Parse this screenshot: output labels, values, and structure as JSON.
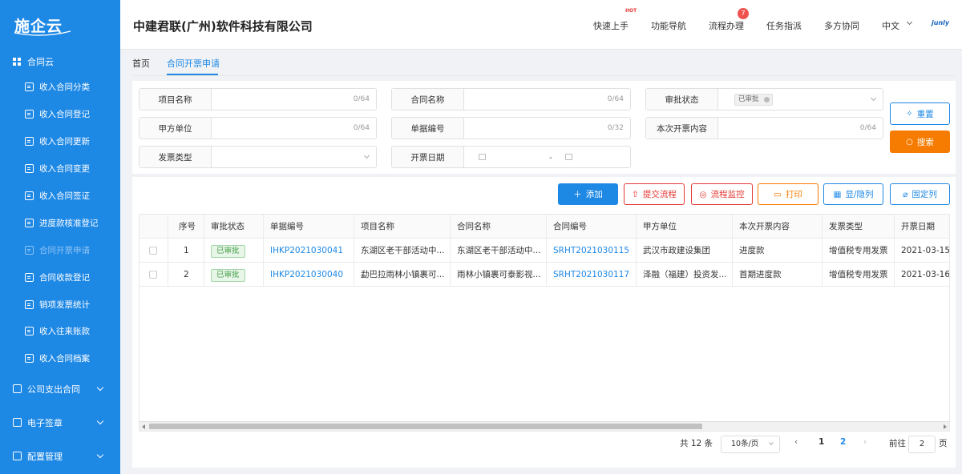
{
  "app": {
    "logo": "施企云",
    "company": "中建君联(广州)软件科技有限公司",
    "brand": "junly"
  },
  "colors": {
    "primary": "#1e88e5",
    "sidebar": "#1e88e5",
    "search_button": "#f57c00",
    "status_ok": "#43a047"
  },
  "topnav": {
    "quick_start": "快速上手",
    "hot_label": "HOT",
    "feature_nav": "功能导航",
    "process": "流程办理",
    "process_badge": "7",
    "task": "任务指派",
    "collab": "多方协同",
    "language": "中文"
  },
  "sidebar": {
    "group_title": "合同云",
    "items": [
      {
        "label": "收入合同分类"
      },
      {
        "label": "收入合同登记"
      },
      {
        "label": "收入合同更新"
      },
      {
        "label": "收入合同变更"
      },
      {
        "label": "收入合同签证"
      },
      {
        "label": "进度款核准登记"
      },
      {
        "label": "合同开票申请"
      },
      {
        "label": "合同收款登记"
      },
      {
        "label": "销项发票统计"
      },
      {
        "label": "收入往来账款"
      },
      {
        "label": "收入合同档案"
      }
    ],
    "sections": [
      {
        "label": "公司支出合同"
      },
      {
        "label": "电子签章"
      },
      {
        "label": "配置管理"
      }
    ]
  },
  "tabs": {
    "home": "首页",
    "current": "合同开票申请"
  },
  "search": {
    "project_name": {
      "label": "项目名称",
      "count": "0/64"
    },
    "contract_name": {
      "label": "合同名称",
      "count": "0/64"
    },
    "approval_status": {
      "label": "审批状态",
      "tag": "已审批"
    },
    "party_a": {
      "label": "甲方单位",
      "count": "0/64"
    },
    "doc_number": {
      "label": "单据编号",
      "count": "0/32"
    },
    "invoice_content": {
      "label": "本次开票内容",
      "count": "0/64"
    },
    "invoice_type": {
      "label": "发票类型"
    },
    "invoice_date": {
      "label": "开票日期",
      "separator": "-"
    },
    "reset": "重置",
    "search": "搜索"
  },
  "toolbar": {
    "add": "添加",
    "submit": "提交流程",
    "monitor": "流程监控",
    "print": "打印",
    "show_hide": "显/隐列",
    "fix_col": "固定列"
  },
  "table": {
    "columns": [
      "序号",
      "审批状态",
      "单据编号",
      "项目名称",
      "合同名称",
      "合同编号",
      "甲方单位",
      "本次开票内容",
      "发票类型",
      "开票日期"
    ],
    "rows": [
      {
        "no": "1",
        "status": "已审批",
        "doc": "IHKP2021030041",
        "project": "东湖区老干部活动中...",
        "contract": "东湖区老干部活动中...",
        "code": "SRHT2021030115",
        "party": "武汉市政建设集团",
        "content": "进度款",
        "type": "增值税专用发票",
        "date": "2021-03-15"
      },
      {
        "no": "2",
        "status": "已审批",
        "doc": "IHKP2021030040",
        "project": "勐巴拉雨林小镇裹可...",
        "contract": "雨林小镇裹可泰影视...",
        "code": "SRHT2021030117",
        "party": "泽融（福建）投资发...",
        "content": "首期进度款",
        "type": "增值税专用发票",
        "date": "2021-03-16"
      }
    ]
  },
  "pagination": {
    "total": "共 12 条",
    "page_size": "10条/页",
    "prev": "‹",
    "page1": "1",
    "page2": "2",
    "next": "›",
    "goto_label": "前往",
    "goto_value": "2",
    "goto_unit": "页"
  }
}
